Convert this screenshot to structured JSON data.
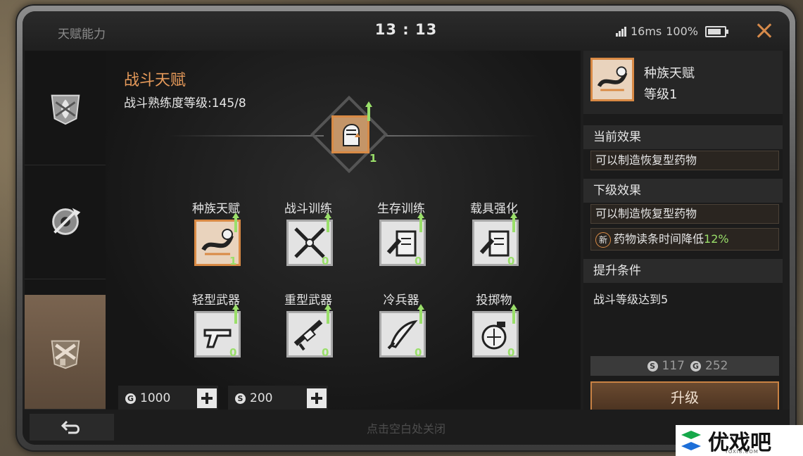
{
  "status": {
    "title": "天赋能力",
    "time": "13 : 13",
    "latency": "16ms",
    "battery": "100%"
  },
  "main": {
    "title": "战斗天赋",
    "subtitle": "战斗熟练度等级:145/8",
    "center_level": "1",
    "skills": [
      {
        "name": "种族天赋",
        "level": "1",
        "icon": "tentacle-icon"
      },
      {
        "name": "战斗训练",
        "level": "0",
        "icon": "crossed-blades-icon"
      },
      {
        "name": "生存训练",
        "level": "0",
        "icon": "card-icon"
      },
      {
        "name": "载具强化",
        "level": "0",
        "icon": "card-icon"
      },
      {
        "name": "轻型武器",
        "level": "0",
        "icon": "pistol-icon"
      },
      {
        "name": "重型武器",
        "level": "0",
        "icon": "heavy-gun-icon"
      },
      {
        "name": "冷兵器",
        "level": "0",
        "icon": "scimitar-icon"
      },
      {
        "name": "投掷物",
        "level": "0",
        "icon": "grenade-icon"
      }
    ],
    "currency_gold": "1000",
    "currency_silver": "200"
  },
  "panel": {
    "name": "种族天赋",
    "level": "等级1",
    "current_effect_label": "当前效果",
    "current_effect": "可以制造恢复型药物",
    "next_effect_label": "下级效果",
    "next_effect": "可以制造恢复型药物",
    "new_badge": "新",
    "new_effect_text": "药物读条时间降低",
    "new_effect_value": "12%",
    "condition_label": "提升条件",
    "condition": "战斗等级达到5",
    "cost_silver": "117",
    "cost_gold": "252",
    "upgrade_label": "升级"
  },
  "footer": {
    "hint": "点击空白处关闭"
  },
  "watermark": {
    "text": "优戏吧",
    "url": "YOXI8.COM"
  },
  "colors": {
    "accent": "#d98a45",
    "level_green": "#9adf6a",
    "title_orange": "#e69a5a"
  }
}
